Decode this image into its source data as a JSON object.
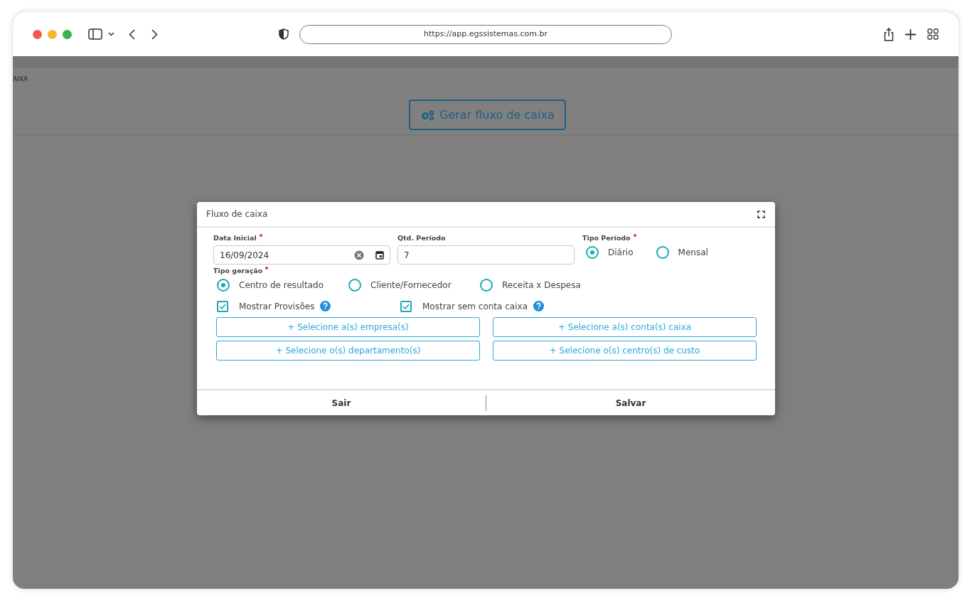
{
  "browser": {
    "url": "https://app.egssistemas.com.br"
  },
  "page": {
    "breadcrumb": "AIXA",
    "generate_button": "Gerar fluxo de caixa"
  },
  "modal": {
    "title": "Fluxo de caixa",
    "date_field": {
      "label": "Data Inicial",
      "required": true,
      "value": "16/09/2024"
    },
    "period_field": {
      "label": "Qtd. Período",
      "required": false,
      "value": "7"
    },
    "period_type": {
      "label": "Tipo Período",
      "required": true,
      "options": [
        {
          "label": "Diário",
          "selected": true
        },
        {
          "label": "Mensal",
          "selected": false
        }
      ]
    },
    "generation_type": {
      "label": "Tipo geração",
      "required": true,
      "options": [
        {
          "label": "Centro de resultado",
          "selected": true
        },
        {
          "label": "Cliente/Fornecedor",
          "selected": false
        },
        {
          "label": "Receita x Despesa",
          "selected": false
        }
      ]
    },
    "checkboxes": [
      {
        "label": "Mostrar Provisões",
        "checked": true
      },
      {
        "label": "Mostrar sem conta caixa",
        "checked": true
      }
    ],
    "select_buttons": [
      "+ Selecione a(s) empresa(s)",
      "+ Selecione a(s) conta(s) caixa",
      "+ Selecione o(s) departamento(s)",
      "+ Selecione o(s) centro(s) de custo"
    ],
    "footer_buttons": [
      "Sair",
      "Salvar"
    ]
  }
}
